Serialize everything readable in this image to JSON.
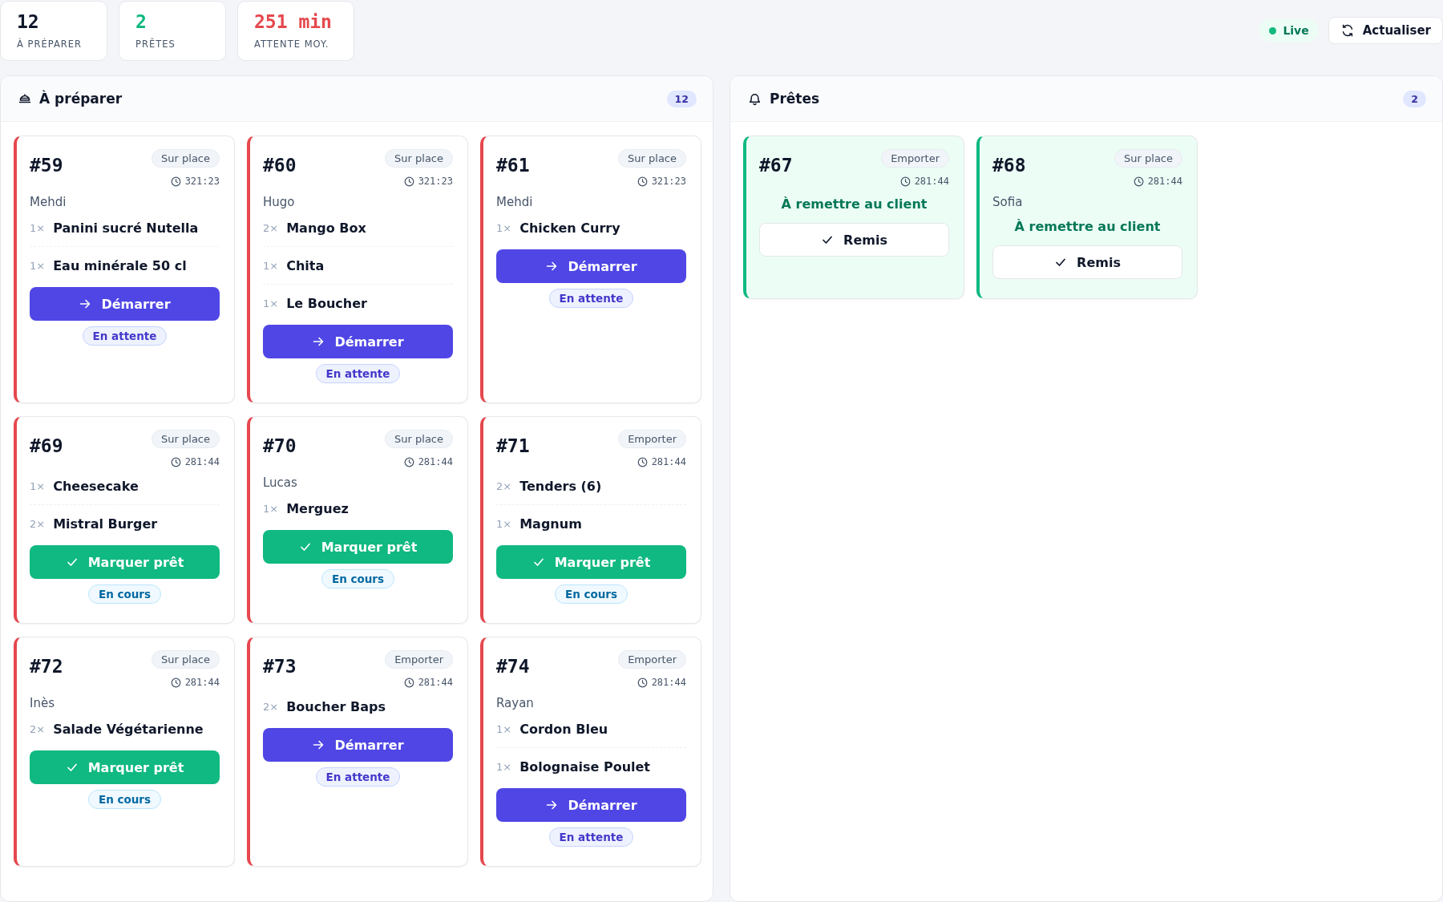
{
  "stats": [
    {
      "value": "12",
      "label": "À PRÉPARER",
      "color": "#0f172a"
    },
    {
      "value": "2",
      "label": "PRÊTES",
      "color": "#10b981"
    },
    {
      "value": "251 min",
      "label": "ATTENTE MOY.",
      "color": "#e5484d"
    }
  ],
  "live": {
    "label": "Live",
    "on": true
  },
  "refresh_button": "Actualiser",
  "columns": [
    {
      "title": "À préparer",
      "kind": "prepare",
      "count": "12",
      "orders": [
        {
          "number": "#59",
          "mode": "Sur place",
          "time": "321:23",
          "customer": "Mehdi",
          "items": [
            {
              "qty": "1×",
              "name": "Panini sucré Nutella"
            },
            {
              "qty": "1×",
              "name": "Eau minérale 50 cl"
            }
          ],
          "kind": "pending",
          "action": "Démarrer",
          "status": "En attente"
        },
        {
          "number": "#60",
          "mode": "Sur place",
          "time": "321:23",
          "customer": "Hugo",
          "items": [
            {
              "qty": "2×",
              "name": "Mango Box"
            },
            {
              "qty": "1×",
              "name": "Chita"
            },
            {
              "qty": "1×",
              "name": "Le Boucher"
            }
          ],
          "kind": "pending",
          "action": "Démarrer",
          "status": "En attente"
        },
        {
          "number": "#61",
          "mode": "Sur place",
          "time": "321:23",
          "customer": "Mehdi",
          "items": [
            {
              "qty": "1×",
              "name": "Chicken Curry"
            }
          ],
          "kind": "pending",
          "action": "Démarrer",
          "status": "En attente"
        },
        {
          "number": "#69",
          "mode": "Sur place",
          "time": "281:44",
          "items": [
            {
              "qty": "1×",
              "name": "Cheesecake"
            },
            {
              "qty": "2×",
              "name": "Mistral Burger"
            }
          ],
          "kind": "cooking",
          "action": "Marquer prêt",
          "status": "En cours"
        },
        {
          "number": "#70",
          "mode": "Sur place",
          "time": "281:44",
          "customer": "Lucas",
          "items": [
            {
              "qty": "1×",
              "name": "Merguez"
            }
          ],
          "kind": "cooking",
          "action": "Marquer prêt",
          "status": "En cours"
        },
        {
          "number": "#71",
          "mode": "Emporter",
          "time": "281:44",
          "items": [
            {
              "qty": "2×",
              "name": "Tenders (6)"
            },
            {
              "qty": "1×",
              "name": "Magnum"
            }
          ],
          "kind": "cooking",
          "action": "Marquer prêt",
          "status": "En cours"
        },
        {
          "number": "#72",
          "mode": "Sur place",
          "time": "281:44",
          "customer": "Inès",
          "items": [
            {
              "qty": "2×",
              "name": "Salade Végétarienne"
            }
          ],
          "kind": "cooking",
          "action": "Marquer prêt",
          "status": "En cours"
        },
        {
          "number": "#73",
          "mode": "Emporter",
          "time": "281:44",
          "items": [
            {
              "qty": "2×",
              "name": "Boucher Baps"
            }
          ],
          "kind": "pending",
          "action": "Démarrer",
          "status": "En attente"
        },
        {
          "number": "#74",
          "mode": "Emporter",
          "time": "281:44",
          "customer": "Rayan",
          "items": [
            {
              "qty": "1×",
              "name": "Cordon Bleu"
            },
            {
              "qty": "1×",
              "name": "Bolognaise Poulet"
            }
          ],
          "kind": "pending",
          "action": "Démarrer",
          "status": "En attente"
        }
      ]
    },
    {
      "title": "Prêtes",
      "kind": "ready",
      "count": "2",
      "orders": [
        {
          "number": "#67",
          "mode": "Emporter",
          "time": "281:44",
          "kind": "ready",
          "message": "À remettre au client",
          "action": "Remis"
        },
        {
          "number": "#68",
          "mode": "Sur place",
          "time": "281:44",
          "customer": "Sofia",
          "kind": "ready",
          "message": "À remettre au client",
          "action": "Remis"
        }
      ]
    }
  ]
}
